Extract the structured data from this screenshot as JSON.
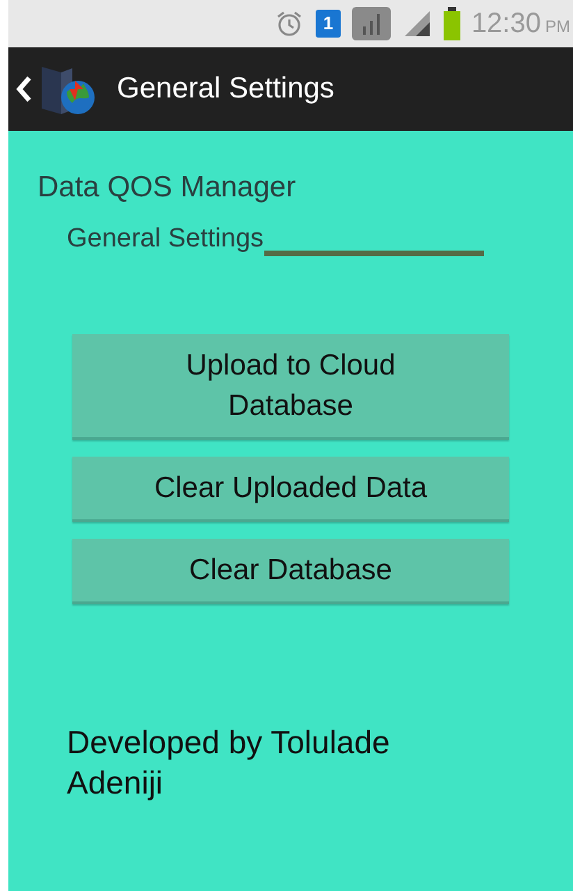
{
  "status_bar": {
    "time": "12:30",
    "ampm": "PM",
    "sim": "1"
  },
  "action_bar": {
    "title": "General Settings"
  },
  "app_title": "Data QOS Manager",
  "section": "General Settings",
  "buttons": [
    "Upload to Cloud Database",
    "Clear Uploaded Data",
    "Clear Database"
  ],
  "footer": "Developed by Tolulade Adeniji"
}
